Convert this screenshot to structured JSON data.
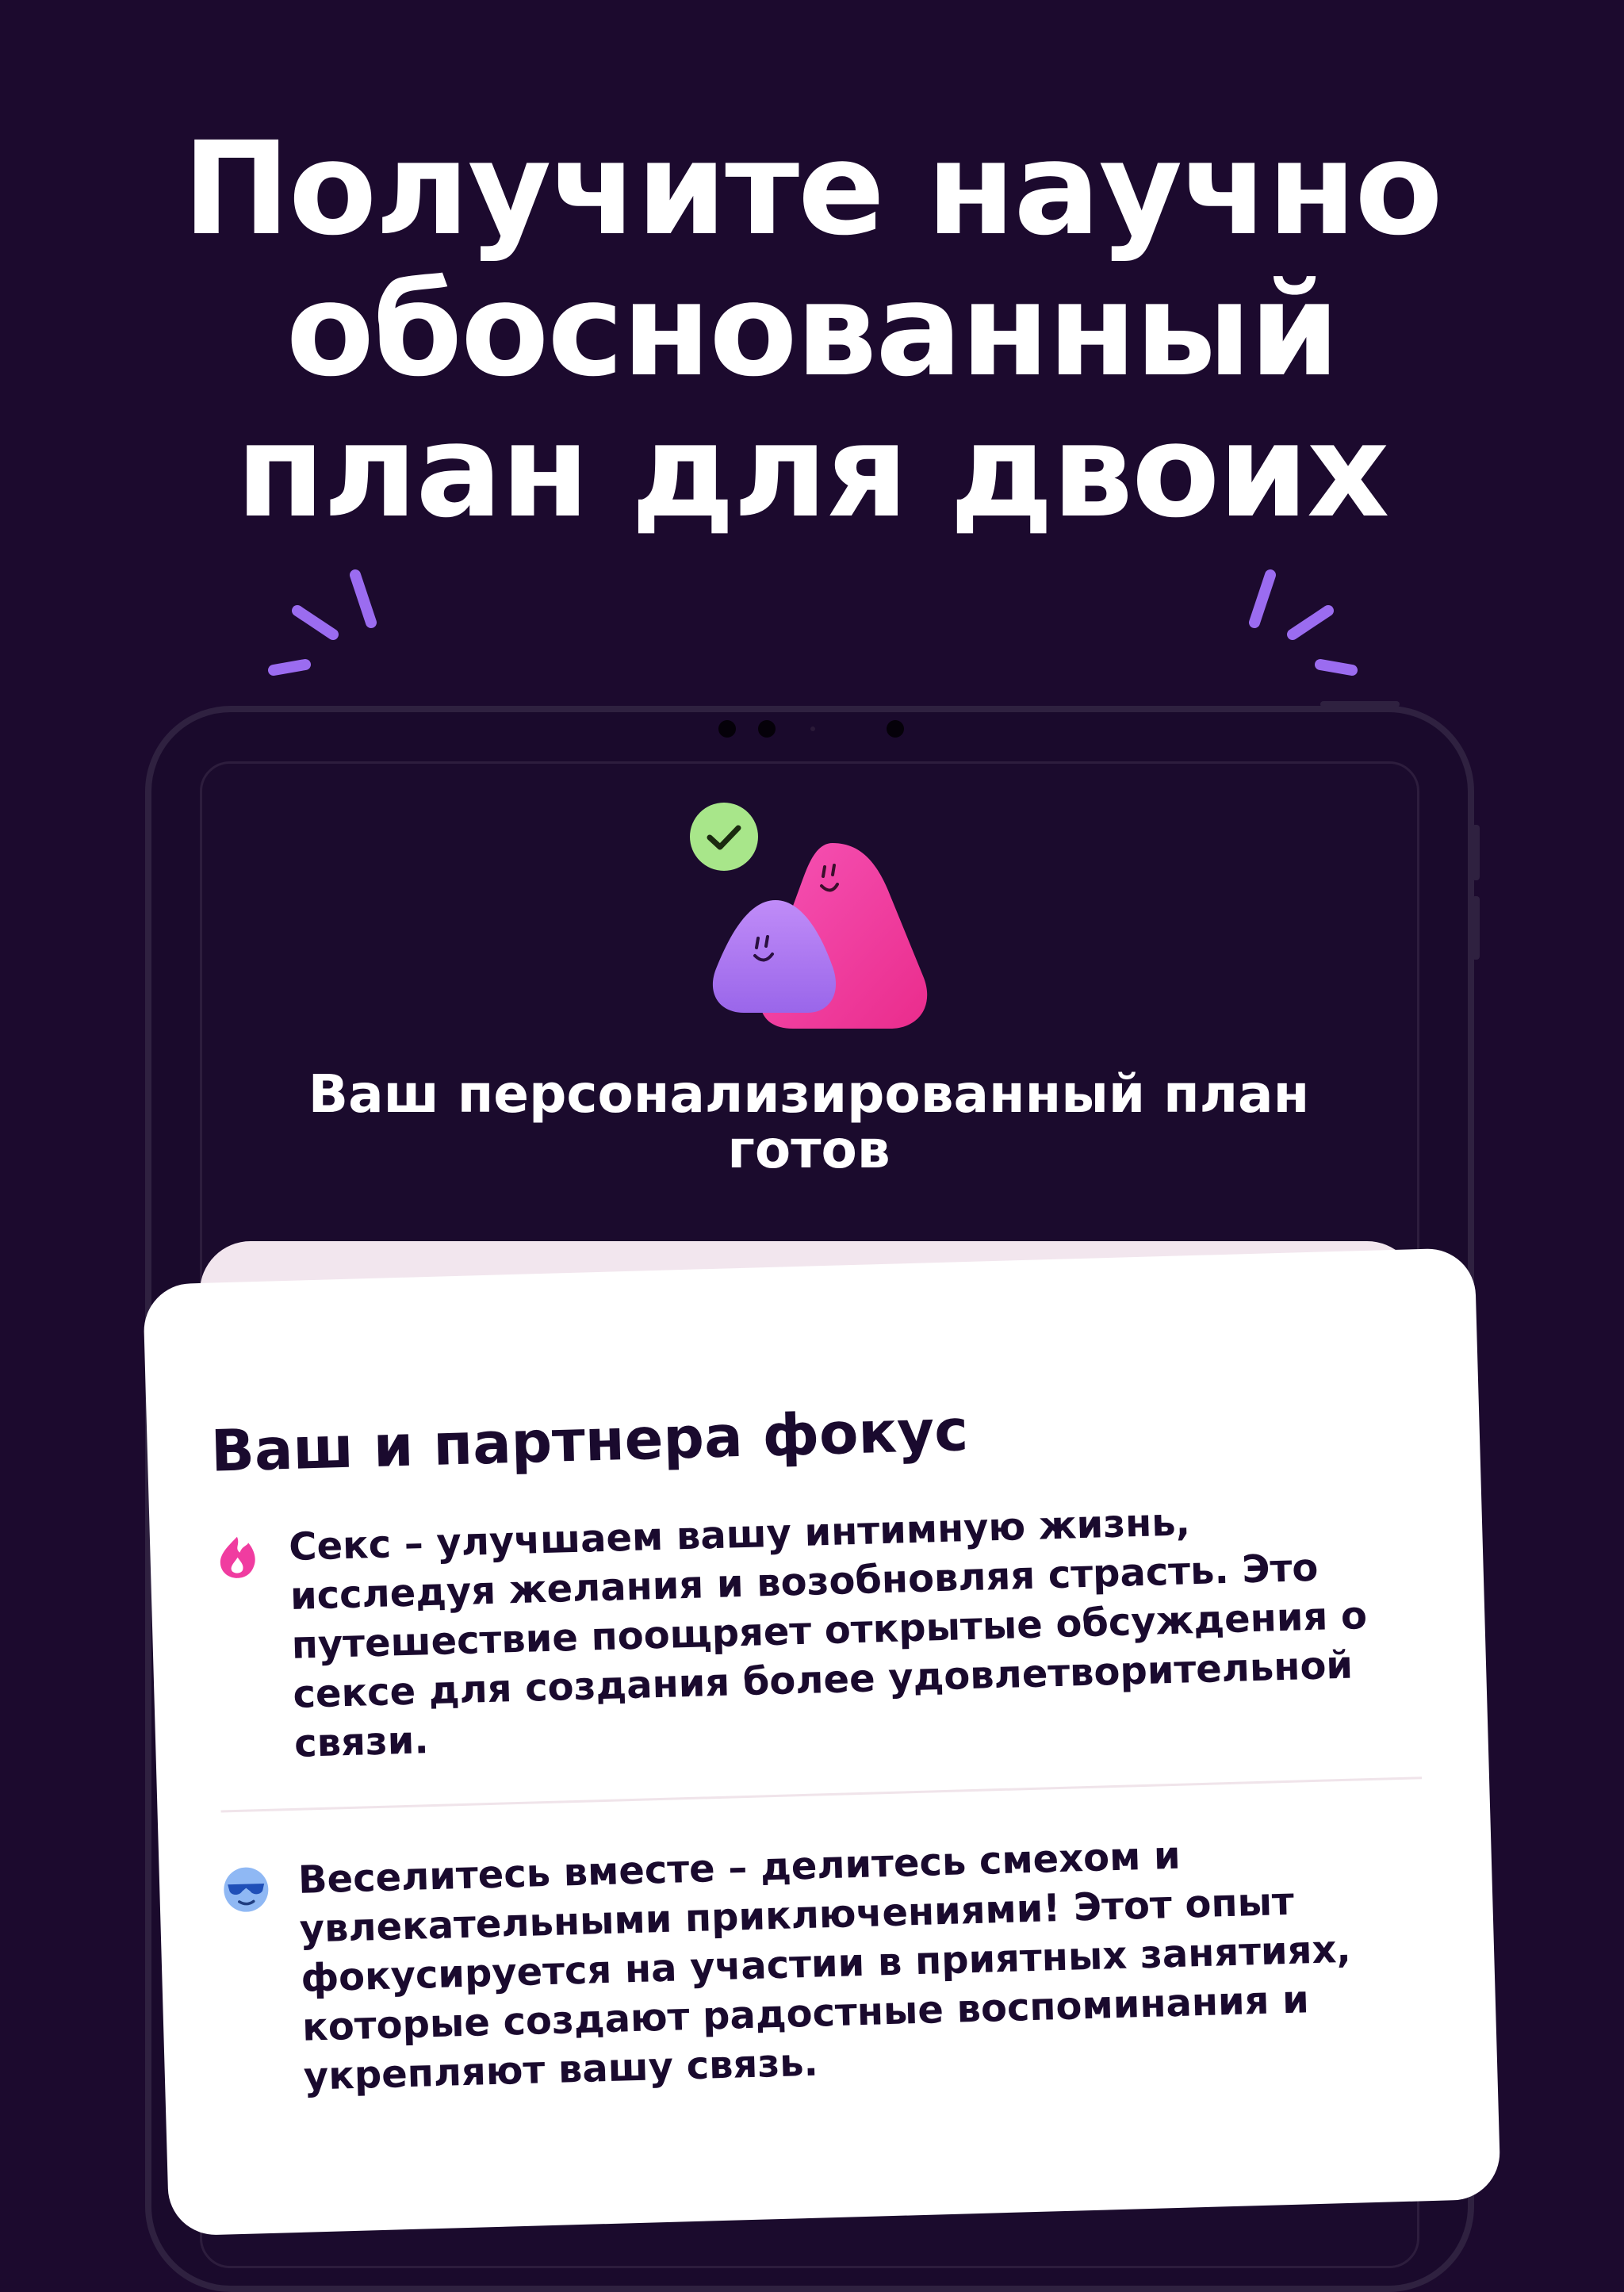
{
  "headline": {
    "line1": "Получите научно",
    "line2": "обоснованный",
    "line3": "план для двоих"
  },
  "plan": {
    "title_line1": "Ваш персонализированный план",
    "title_line2": "готов"
  },
  "focus_card": {
    "title": "Ваш и партнера фокус",
    "items": [
      {
        "icon": "flame-icon",
        "text": "Секс – улучшаем вашу интимную жизнь, исследуя желания и возобновляя страсть. Это путешествие поощряет открытые обсуждения о сексе для создания более удовлетворительной связи."
      },
      {
        "icon": "sunglasses-smiley-icon",
        "text": "Веселитесь вместе – делитесь смехом и увлекательными приключениями! Этот опыт фокусируется на участии в приятных занятиях, которые создают радостные воспоминания и укрепляют вашу связь."
      }
    ]
  },
  "colors": {
    "background": "#1c0a2e",
    "accent_purple": "#a06ef0",
    "accent_pink": "#f03ca0",
    "check_green": "#a8e68a",
    "card": "#ffffff",
    "text_dark": "#1a0a2e"
  }
}
